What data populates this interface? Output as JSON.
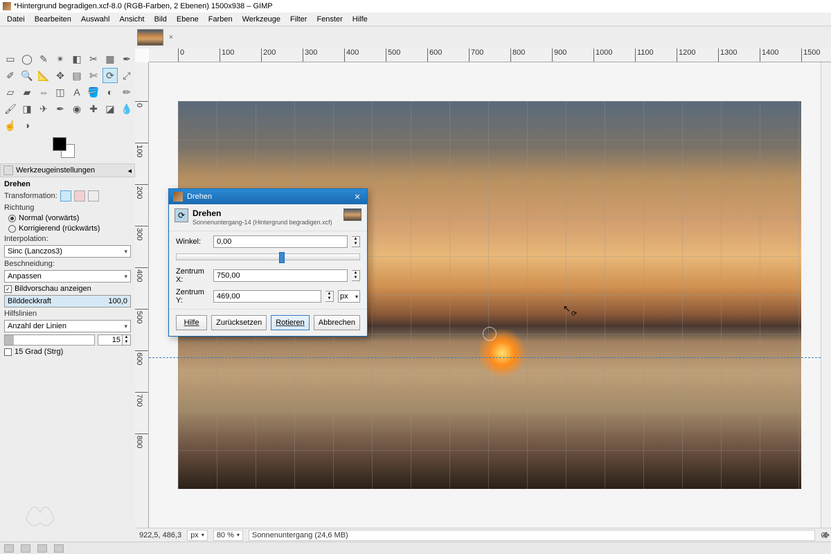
{
  "title": "*Hintergrund begradigen.xcf-8.0 (RGB-Farben, 2 Ebenen) 1500x938 – GIMP",
  "menu": [
    "Datei",
    "Bearbeiten",
    "Auswahl",
    "Ansicht",
    "Bild",
    "Ebene",
    "Farben",
    "Werkzeuge",
    "Filter",
    "Fenster",
    "Hilfe"
  ],
  "dock_title": "Werkzeugeinstellungen",
  "opts": {
    "tool_name": "Drehen",
    "transformation": "Transformation:",
    "richtung": "Richtung",
    "dir_normal": "Normal (vorwärts)",
    "dir_corr": "Korrigierend (rückwärts)",
    "interpolation": "Interpolation:",
    "interp_val": "Sinc (Lanczos3)",
    "beschneidung": "Beschneidung:",
    "besch_val": "Anpassen",
    "preview": "Bildvorschau anzeigen",
    "opacity_label": "Bilddeckkraft",
    "opacity_val": "100,0",
    "hilfslinien": "Hilfslinien",
    "hilfs_val": "Anzahl der Linien",
    "lines_val": "15",
    "constrain": "15 Grad (Strg)"
  },
  "ruler_h": [
    "0",
    "100",
    "200",
    "300",
    "400",
    "500",
    "600",
    "700",
    "800",
    "900",
    "1000",
    "1100",
    "1200",
    "1300",
    "1400",
    "1500"
  ],
  "ruler_v": [
    "0",
    "100",
    "200",
    "300",
    "400",
    "500",
    "600",
    "700",
    "800"
  ],
  "dialog": {
    "title": "Drehen",
    "heading": "Drehen",
    "sub": "Sonnenuntergang-14 (Hintergrund begradigen.xcf)",
    "winkel": "Winkel:",
    "winkel_v": "0,00",
    "cx": "Zentrum X:",
    "cx_v": "750,00",
    "cy": "Zentrum Y:",
    "cy_v": "469,00",
    "unit": "px",
    "hilfe": "Hilfe",
    "reset": "Zurücksetzen",
    "rotate": "Rotieren",
    "cancel": "Abbrechen"
  },
  "status": {
    "coords": "922,5, 486,3",
    "unit": "px",
    "zoom": "80 %",
    "file": "Sonnenuntergang (24,6 MB)"
  }
}
